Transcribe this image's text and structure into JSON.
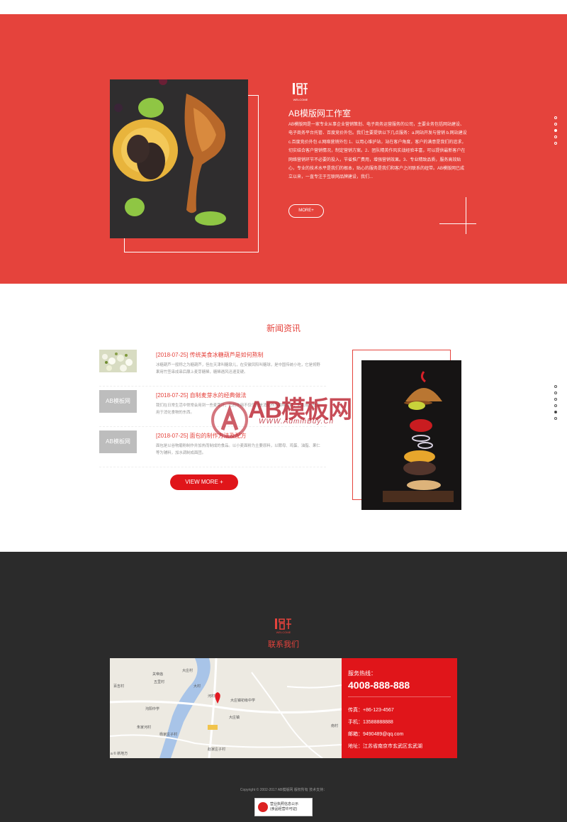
{
  "about": {
    "logo_caption": "WELCOME",
    "title": "AB模版网工作室",
    "text": "AB模版网是一家专业从事企业营销策划、电子商务运营服务的公司，主要业务包括网站建设、电子商务平台托管、百度竞价外包。我们主要提供以下几点服务：a.网站开发与营销 b.网站建设 c.百度竞价外包 d.网络营销外包 1、以用心维护站，站在客户角度，客户的满意是我们的追求，切实结合客户营销情况，制定营销方案。2、团队精英作风实战经验丰富，可以提供最新客户在网络营销环节不必要的投入，节省推广费用，增强营销效果。3、专业精致品质，服务高效贴心，专业的技术水平是我们的根本，贴心的服务是我们和客户之间联系的纽带。AB模版网已成立以来，一直专注于互联网品牌建设，我们...",
    "more_label": "MORE+",
    "pager_count": 5
  },
  "news": {
    "heading": "新闻资讯",
    "items": [
      {
        "date_title": "[2018-07-25] 传统美食冰糖葫芦是如何熬制",
        "summary": "冰糖葫芦一般称之为糖葫芦，但在天津叫糖墩儿，在安徽凤阳叫糖球，是中国传统小吃，它是将野果用竹签串成串后蘸上麦芽糖稀，糖稀遇风迅速变硬。",
        "thumb": ""
      },
      {
        "date_title": "[2018-07-25] 自制麦芽水的经典做法",
        "summary": "我们在日常生活中常常会用到一些麦芽汁，它的作用不仅仅只是消化作为甜味饮料，而且有一些专用于消化食物的东西。",
        "thumb": "AB模板网"
      },
      {
        "date_title": "[2018-07-25] 面包的制作方法及配方",
        "summary": "面包是以谷物磨粉制作并加热而制成的食品。以小麦面粉为主要原料，以酵母、鸡蛋、油脂、果仁等为辅料，加水调制成面团。",
        "thumb": "AB模板网"
      }
    ],
    "view_more_label": "VIEW MORE +",
    "pager_count": 6
  },
  "watermark": {
    "title": "AB模板网",
    "url": "WWW.AdminBuy.Cn"
  },
  "footer": {
    "logo_caption": "WELCOME",
    "title": "联系我们",
    "map": {
      "labels": [
        "大庄村",
        "大庄镇",
        "大庄镇初级中学",
        "关帝庙",
        "五里村",
        "大村",
        "百吉村",
        "沟阳中学",
        "朱家河村",
        "杨家庄子村",
        "赵家庄子村",
        "河村",
        "南村",
        "a © 新地方"
      ]
    },
    "contact": {
      "hotline_label": "服务热线：",
      "hotline": "4008-888-888",
      "fax": "传真：+86-123-4567",
      "phone": "手机：13588888888",
      "email": "邮箱：9490489@qq.com",
      "address": "地址：江苏省南京市玄武区玄武湖"
    },
    "copyright": "Copyright © 2002-2017 AB模版网 版权所有 技术支持：",
    "badge_line1": "营业执照信息公示",
    "badge_line2": "(食品经营许可证)"
  },
  "colors": {
    "brand_red": "#e5433c",
    "button_red": "#e0151a",
    "footer_bg": "#2b2b2b"
  }
}
